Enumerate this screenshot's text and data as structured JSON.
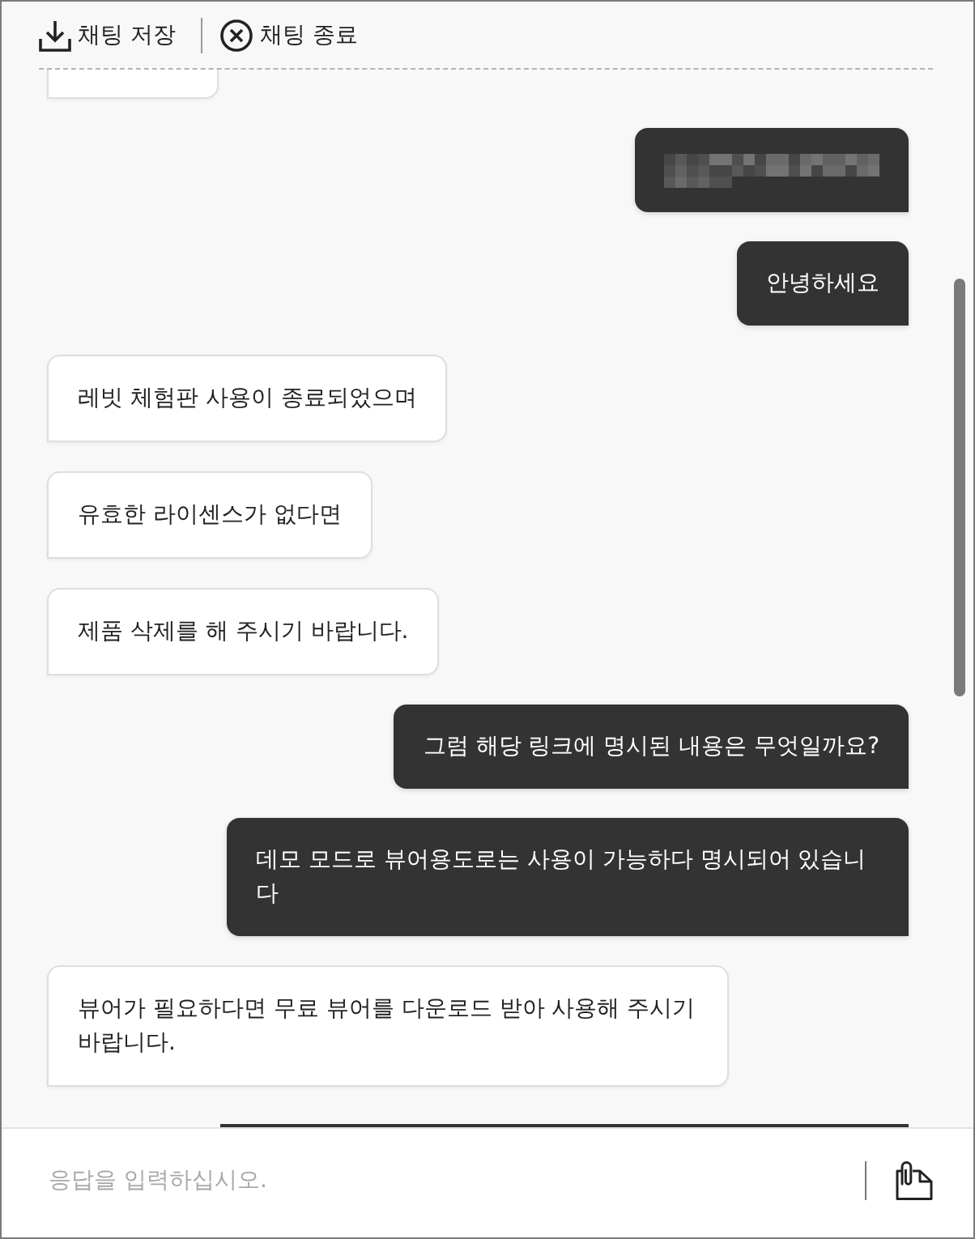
{
  "toolbar": [
    {
      "kind": "save",
      "label": "채팅 저장"
    },
    {
      "kind": "end",
      "label": "채팅 종료"
    }
  ],
  "messages": [
    {
      "outgoing": false,
      "kind": "partial"
    },
    {
      "outgoing": true,
      "kind": "blurred"
    },
    {
      "outgoing": true,
      "kind": "text",
      "text": "안녕하세요"
    },
    {
      "outgoing": false,
      "kind": "text",
      "text": "레빗 체험판 사용이 종료되었으며"
    },
    {
      "outgoing": false,
      "kind": "text",
      "text": "유효한 라이센스가 없다면"
    },
    {
      "outgoing": false,
      "kind": "text",
      "text": "제품 삭제를 해 주시기 바랍니다."
    },
    {
      "outgoing": true,
      "kind": "text",
      "text": "그럼 해당 링크에 명시된 내용은 무엇일까요?"
    },
    {
      "outgoing": true,
      "kind": "text",
      "text": "데모 모드로 뷰어용도로는 사용이 가능하다 명시되어 있습니다"
    },
    {
      "outgoing": false,
      "kind": "text",
      "text": "뷰어가 필요하다면 무료 뷰어를 다운로드 받아 사용해 주시기 바랍니다."
    },
    {
      "outgoing": true,
      "kind": "partial"
    }
  ],
  "composer": {
    "placeholder": "응답을 입력하십시오."
  }
}
